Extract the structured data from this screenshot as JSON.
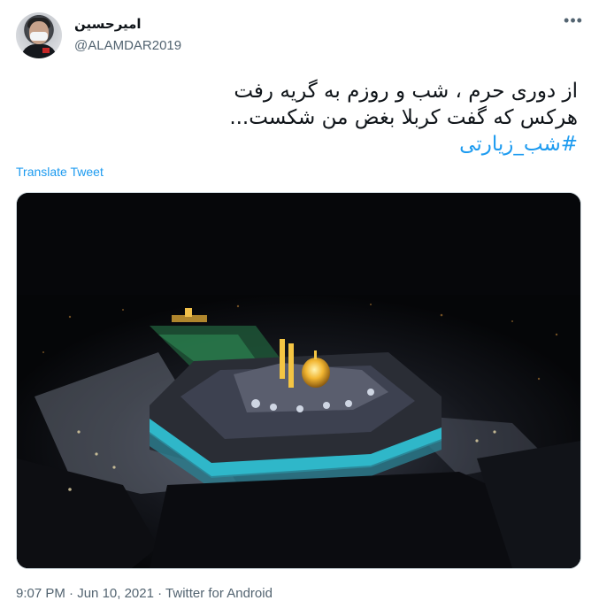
{
  "author": {
    "display_name": "امیرحسین",
    "handle": "@ALAMDAR2019"
  },
  "more_icon": "more-horizontal-icon",
  "tweet": {
    "lines": [
      "از دوری حرم ، شب و روزم به گریه رفت",
      "هرکس که گفت کربلا بغض من شکست..."
    ],
    "hashtag": "#شب_زیارتی"
  },
  "translate_label": "Translate Tweet",
  "meta": {
    "time": "9:07 PM",
    "sep1": " · ",
    "date": "Jun 10, 2021",
    "sep2": " · ",
    "source": "Twitter for Android"
  },
  "colors": {
    "link": "#1d9bf0",
    "secondary_text": "#536471",
    "border": "#cfd9de"
  }
}
